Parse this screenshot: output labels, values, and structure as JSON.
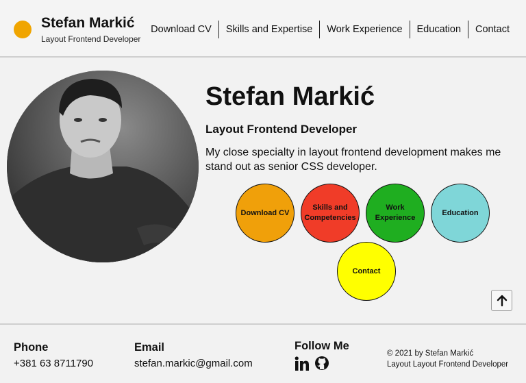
{
  "header": {
    "name": "Stefan Markić",
    "role": "Layout Frontend Developer",
    "accent": "#f0a500"
  },
  "nav": [
    {
      "label": "Download CV"
    },
    {
      "label": "Skills and Expertise"
    },
    {
      "label": "Work Experience"
    },
    {
      "label": "Education"
    },
    {
      "label": "Contact"
    }
  ],
  "hero": {
    "name": "Stefan Markić",
    "role": "Layout Frontend Developer",
    "description": "My close specialty in layout frontend development makes me stand out as senior CSS developer.",
    "buttons": [
      {
        "label": "Download CV",
        "color": "#f0a00a"
      },
      {
        "label": "Skills and Competencies",
        "color": "#f03c28"
      },
      {
        "label": "Work Experience",
        "color": "#1fae20"
      },
      {
        "label": "Education",
        "color": "#7fd6d8"
      },
      {
        "label": "Contact",
        "color": "#ffff00"
      }
    ]
  },
  "footer": {
    "phone_heading": "Phone",
    "phone": "+381 63 8711790",
    "email_heading": "Email",
    "email": "stefan.markic@gmail.com",
    "follow_heading": "Follow Me",
    "social_icons": [
      "linkedin-icon",
      "github-icon"
    ],
    "copyright": "© 2021 by Stefan Markić",
    "tagline": "Layout Layout Frontend Developer"
  }
}
